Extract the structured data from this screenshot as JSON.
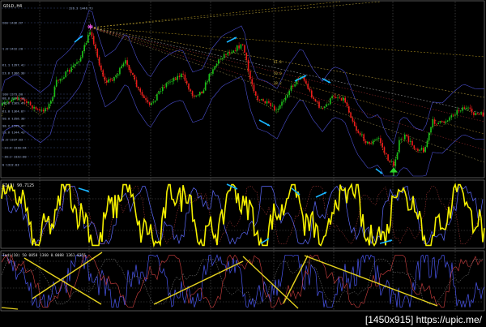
{
  "window": {
    "title": "GOLD,H4"
  },
  "panels": {
    "oscillator1": {
      "label": "SI(3) 90.7125"
    },
    "oscillator2": {
      "label": "Indi(10) 50 0858 1360 0.0088 1361 8355"
    }
  },
  "fib_levels": [
    {
      "label": "226.3 1446.73"
    },
    {
      "label": "200 1436.97"
    },
    {
      "label": "1.8 1412.20"
    },
    {
      "label": "61.1 1397.41"
    },
    {
      "label": "23.6 1386.38"
    },
    {
      "label": "100 1373.60"
    },
    {
      "label": "88.6 1371.18"
    },
    {
      "label": "78.6 1369.47"
    },
    {
      "label": "61.8 1364.87"
    },
    {
      "label": "50.0 1356.38"
    },
    {
      "label": "38.2 1349.47"
    },
    {
      "label": "23.6 1344.43"
    },
    {
      "label": "0.0 1337.83"
    },
    {
      "label": "-23.6 1330.94"
    },
    {
      "label": "-38.2 1322.80"
    },
    {
      "label": "0 1312.83"
    }
  ],
  "fan_labels": [
    "61.8",
    "50.0",
    "38.2"
  ],
  "colors": {
    "bull_candle": "#19c219",
    "bear_candle": "#ee1b1b",
    "oscillator_main": "#f4f000",
    "signal_blue": "#5e6bff",
    "arrow": "#19b4ff",
    "trendline": "#e6d21e",
    "fib_label": "#9aa9c8"
  },
  "footer": {
    "watermark": "[1450x915] https://upic.me/"
  }
}
